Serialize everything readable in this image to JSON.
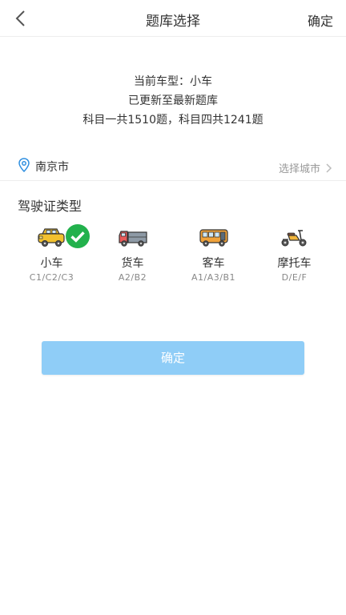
{
  "nav": {
    "title": "题库选择",
    "confirm_label": "确定"
  },
  "info": {
    "current_type": "当前车型：小车",
    "updated": "已更新至最新题库",
    "counts": "科目一共1510题，科目四共1241题"
  },
  "city": {
    "name": "南京市",
    "select_label": "选择城市"
  },
  "license": {
    "section_title": "驾驶证类型",
    "types": [
      {
        "name": "小车",
        "codes": "C1/C2/C3",
        "icon": "car-icon",
        "selected": true
      },
      {
        "name": "货车",
        "codes": "A2/B2",
        "icon": "truck-icon",
        "selected": false
      },
      {
        "name": "客车",
        "codes": "A1/A3/B1",
        "icon": "bus-icon",
        "selected": false
      },
      {
        "name": "摩托车",
        "codes": "D/E/F",
        "icon": "motorcycle-icon",
        "selected": false
      }
    ]
  },
  "main_button": {
    "label": "确定"
  },
  "colors": {
    "button_bg": "#8fcdf7",
    "accent_blue": "#2f8fe0",
    "check_green": "#22b14c"
  }
}
